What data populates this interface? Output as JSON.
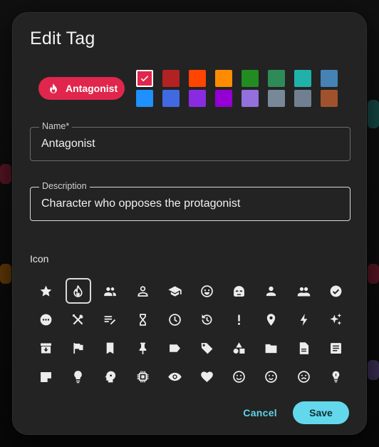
{
  "dialog": {
    "title": "Edit Tag"
  },
  "tag_preview": {
    "label": "Antagonist",
    "color": "#e0264c",
    "icon": "fire-icon"
  },
  "colors": {
    "selected_index": 0,
    "swatches": [
      "#e0264c",
      "#b22222",
      "#ff4500",
      "#ff8c00",
      "#228b22",
      "#2e8b57",
      "#20b2aa",
      "#4682b4",
      "#1e90ff",
      "#4169e1",
      "#8a2be2",
      "#9400d3",
      "#9370db",
      "#778899",
      "#708090",
      "#a0522d"
    ]
  },
  "fields": {
    "name": {
      "label": "Name*",
      "value": "Antagonist"
    },
    "description": {
      "label": "Description",
      "value": "Character who opposes the protagonist"
    }
  },
  "icons": {
    "section_label": "Icon",
    "selected_index": 1,
    "items": [
      "star-icon",
      "fire-icon",
      "group-icon",
      "person-outline-icon",
      "school-icon",
      "mood-icon",
      "masked-face-icon",
      "person-icon",
      "people-icon",
      "check-circle-icon",
      "more-horiz-icon",
      "tools-icon",
      "edit-note-icon",
      "hourglass-icon",
      "clock-icon",
      "restore-icon",
      "exclamation-icon",
      "location-pin-icon",
      "bolt-icon",
      "sparkles-icon",
      "archive-icon",
      "flag-icon",
      "bookmark-icon",
      "push-pin-icon",
      "label-icon",
      "tag-icon",
      "shapes-icon",
      "folder-icon",
      "description-icon",
      "article-icon",
      "sticky-note-icon",
      "lightbulb-icon",
      "psychology-icon",
      "chip-icon",
      "eye-icon",
      "heart-icon",
      "smile-icon",
      "smile-outline-icon",
      "neutral-face-icon",
      "tips-icon"
    ]
  },
  "actions": {
    "cancel": "Cancel",
    "save": "Save"
  }
}
